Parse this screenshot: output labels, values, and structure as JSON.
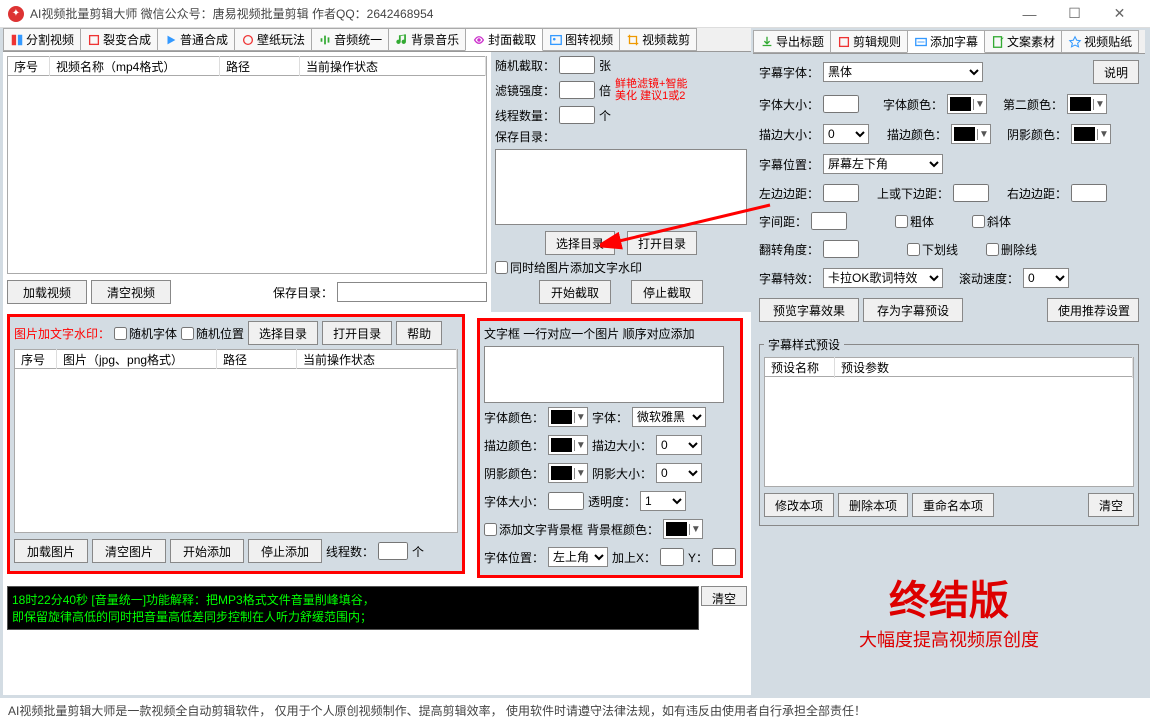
{
  "window": {
    "title": "AI视频批量剪辑大师   微信公众号：唐易视频批量剪辑    作者QQ：2642468954"
  },
  "left_tabs": [
    "分割视频",
    "裂变合成",
    "普通合成",
    "壁纸玩法",
    "音频统一",
    "背景音乐",
    "封面截取",
    "图转视频",
    "视频裁剪"
  ],
  "right_tabs": [
    "导出标题",
    "剪辑规则",
    "添加字幕",
    "文案素材",
    "视频贴纸"
  ],
  "list1": {
    "c1": "序号",
    "c2": "视频名称（mp4格式）",
    "c3": "路径",
    "c4": "当前操作状态"
  },
  "list2": {
    "c1": "序号",
    "c2": "图片（jpg、png格式）",
    "c3": "路径",
    "c4": "当前操作状态"
  },
  "upperL": {
    "load": "加载视频",
    "clear": "清空视频",
    "savedir": "保存目录："
  },
  "upperR": {
    "rand": "随机截取：",
    "zhang": "张",
    "filter": "滤镜强度：",
    "bei": "倍",
    "tip": "鲜艳滤镜+智能\n美化 建议1或2",
    "thread": "线程数量：",
    "ge": "个",
    "savedir": "保存目录：",
    "seldir": "选择目录",
    "opendir": "打开目录",
    "chk": "同时给图片添加文字水印",
    "start": "开始截取",
    "stop": "停止截取"
  },
  "wm": {
    "title": "图片加文字水印：",
    "rfont": "随机字体",
    "rpos": "随机位置",
    "seldir": "选择目录",
    "opendir": "打开目录",
    "help": "帮助",
    "load": "加载图片",
    "clear": "清空图片",
    "start": "开始添加",
    "stop": "停止添加",
    "thread": "线程数：",
    "ge": "个"
  },
  "txtbox": {
    "title": "文字框 一行对应一个图片 顺序对应添加",
    "fontcolor": "字体颜色：",
    "font": "字体：",
    "fontval": "微软雅黑",
    "stroke": "描边颜色：",
    "strokesz": "描边大小：",
    "shadow": "阴影颜色：",
    "shadowsz": "阴影大小：",
    "fontsize": "字体大小：",
    "opacity": "透明度：",
    "addbg": "添加文字背景框",
    "bgcolor": "背景框颜色：",
    "pos": "字体位置：",
    "posval": "左上角",
    "addx": "加上X：",
    "y": "Y："
  },
  "subtitle": {
    "desc": "说明",
    "font": "字幕字体：",
    "fontval": "黑体",
    "size": "字体大小：",
    "color": "字体颜色：",
    "color2": "第二颜色：",
    "strokesz": "描边大小：",
    "strokeszval": "0",
    "strokecolor": "描边颜色：",
    "shadowcolor": "阴影颜色：",
    "pos": "字幕位置：",
    "posval": "屏幕左下角",
    "leftm": "左边边距：",
    "topm": "上或下边距：",
    "rightm": "右边边距：",
    "spacing": "字间距：",
    "bold": "粗体",
    "italic": "斜体",
    "angle": "翻转角度：",
    "underline": "下划线",
    "strike": "删除线",
    "effect": "字幕特效：",
    "effectval": "卡拉OK歌词特效",
    "speed": "滚动速度：",
    "speedval": "0",
    "preview": "预览字幕效果",
    "save": "存为字幕预设",
    "userec": "使用推荐设置",
    "preset": "字幕样式预设",
    "pname": "预设名称",
    "pparam": "预设参数",
    "edit": "修改本项",
    "del": "删除本项",
    "rename": "重命名本项",
    "clear": "清空"
  },
  "log": {
    "line1": "18时22分40秒 [音量统一]功能解释：把MP3格式文件音量削峰填谷，",
    "line2": "    即保留旋律高低的同时把音量高低差同步控制在人听力舒缓范围内；",
    "clear": "清空"
  },
  "promo": {
    "t1": "终结版",
    "t2": "大幅度提高视频原创度"
  },
  "footer": "AI视频批量剪辑大师是一款视频全自动剪辑软件，   仅用于个人原创视频制作、提高剪辑效率，  使用软件时请遵守法律法规，如有违反由使用者自行承担全部责任！",
  "nums": {
    "zero": "0",
    "one": "1"
  }
}
